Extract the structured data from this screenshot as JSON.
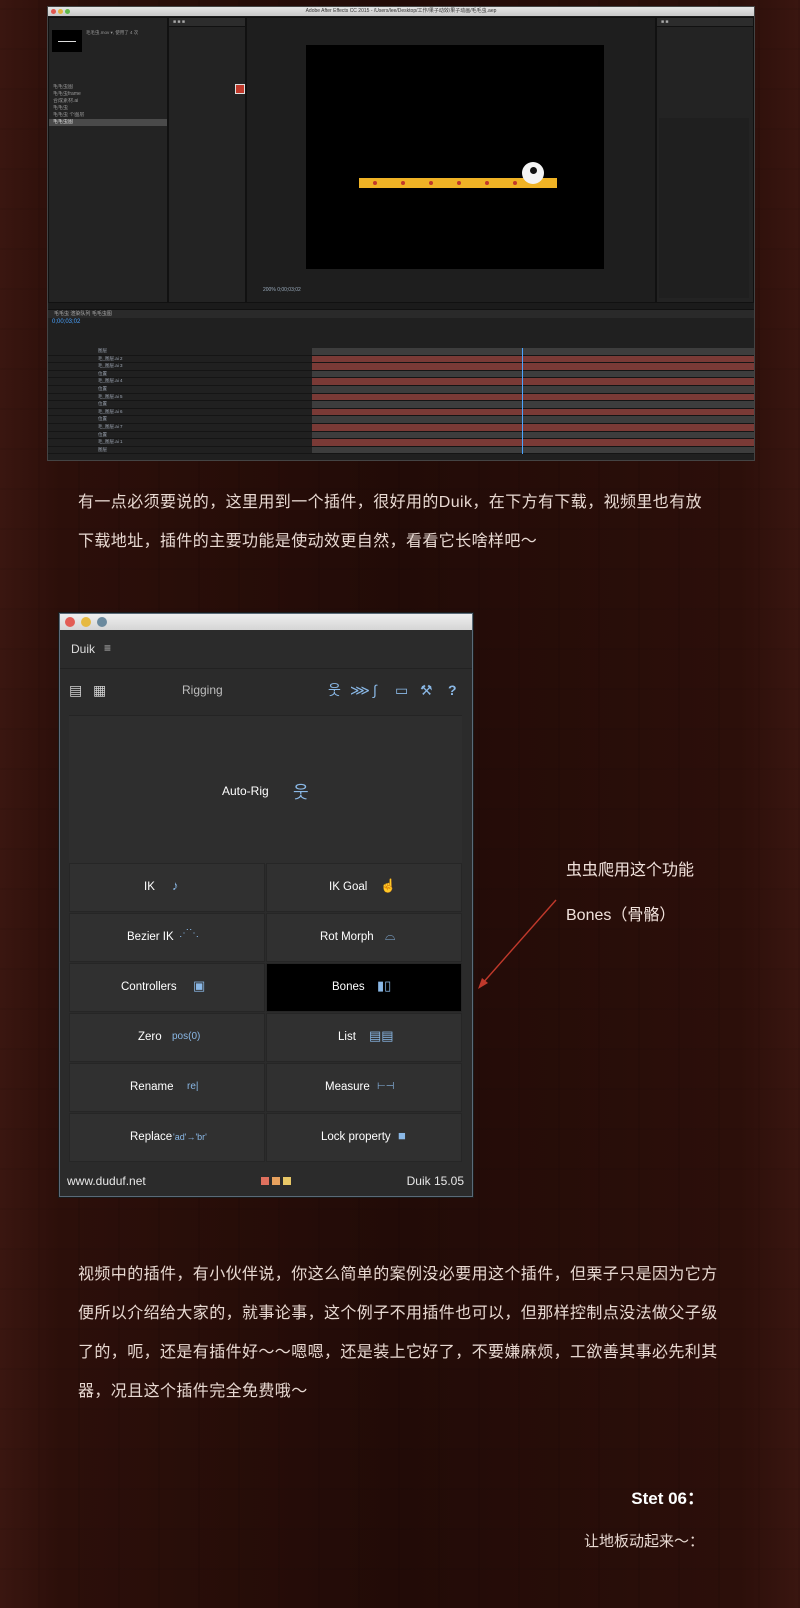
{
  "ae": {
    "title": "Adobe After Effects CC 2015 - /Users/lee/Desktop/工作/果子动效/果子动画/毛毛虫.aep",
    "project_info": "毛毛虫.mov ▾, 使用了 4 次",
    "project_items": [
      "毛毛虫图",
      "毛毛虫frame",
      "合成素材.ai",
      "毛毛虫",
      "毛毛虫 个图层",
      "毛毛虫图"
    ],
    "layers": [
      "图层",
      "毛_图层.ai 2",
      "毛_图层.ai 3",
      "位置",
      "毛_图层.ai 4",
      "位置",
      "毛_图层.ai 5",
      "位置",
      "毛_图层.ai 6",
      "位置",
      "毛_图层.ai 7",
      "位置",
      "毛_图层.ai 1",
      "图层"
    ],
    "timecode": "0;00;03;02",
    "zoom": "200%",
    "timeline_tabs": [
      "毛毛虫",
      "渲染队列",
      "毛毛虫图"
    ]
  },
  "intro_text": "有一点必须要说的，这里用到一个插件，很好用的Duik，在下方有下载，视频里也有放下载地址，插件的主要功能是使动效更自然，看看它长啥样吧～",
  "duik": {
    "name": "Duik",
    "menu": "≡",
    "section": "Rigging",
    "auto_rig": "Auto-Rig",
    "buttons": [
      {
        "label": "IK",
        "icon": "ik-icon",
        "glyph": "♪"
      },
      {
        "label": "IK Goal",
        "icon": "ik-goal-icon",
        "glyph": "☝"
      },
      {
        "label": "Bezier IK",
        "icon": "bezier-ik-icon",
        "glyph": "⋰⋱"
      },
      {
        "label": "Rot Morph",
        "icon": "rot-morph-icon",
        "glyph": "⌓"
      },
      {
        "label": "Controllers",
        "icon": "controllers-icon",
        "glyph": "▣"
      },
      {
        "label": "Bones",
        "icon": "bones-icon",
        "glyph": "▮▯"
      },
      {
        "label": "Zero",
        "icon": "zero-icon",
        "glyph": "pos(0)"
      },
      {
        "label": "List",
        "icon": "list-icon",
        "glyph": "▤▤"
      },
      {
        "label": "Rename",
        "icon": "rename-icon",
        "glyph": "re|"
      },
      {
        "label": "Measure",
        "icon": "measure-icon",
        "glyph": "⊢⊣"
      },
      {
        "label": "Replace",
        "icon": "replace-icon",
        "glyph": "'ad'→'br'"
      },
      {
        "label": "Lock property",
        "icon": "lock-icon",
        "glyph": "🔒"
      }
    ],
    "footer_url": "www.duduf.net",
    "footer_version": "Duik 15.05",
    "swatches": [
      "#e0705e",
      "#e8a15e",
      "#e8c766"
    ]
  },
  "callout": {
    "line1": "虫虫爬用这个功能",
    "line2": "Bones（骨骼）",
    "color": "#c0392b"
  },
  "body_text": "视频中的插件，有小伙伴说，你这么简单的案例没必要用这个插件，但栗子只是因为它方便所以介绍给大家的，就事论事，这个例子不用插件也可以，但那样控制点没法做父子级了的，呃，还是有插件好～～嗯嗯，还是装上它好了，不要嫌麻烦，工欲善其事必先利其器，况且这个插件完全免费哦～",
  "step": {
    "label": "Stet 06：",
    "subtitle": "让地板动起来～："
  }
}
